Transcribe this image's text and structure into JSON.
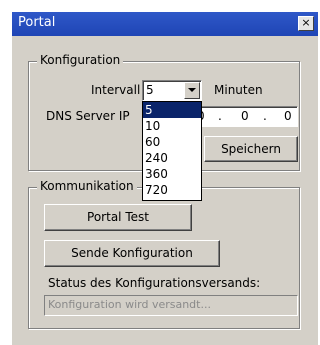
{
  "window": {
    "title": "Portal",
    "close_glyph": "×"
  },
  "konfiguration": {
    "legend": "Konfiguration",
    "intervall_label": "Intervall",
    "intervall_value": "5",
    "intervall_unit": "Minuten",
    "dns_label": "DNS Server IP",
    "ip_segments": [
      "0",
      ".",
      "0",
      ".",
      "0"
    ],
    "save_label": "Speichern",
    "intervall_options": [
      "5",
      "10",
      "60",
      "240",
      "360",
      "720"
    ]
  },
  "kommunikation": {
    "legend": "Kommunikation",
    "portal_test_label": "Portal Test",
    "sende_label": "Sende Konfiguration",
    "status_label": "Status des Konfigurationsversands:",
    "status_value": "Konfiguration wird versandt..."
  },
  "colors": {
    "titlebar": "#1f45b5",
    "selection": "#0a246a",
    "face": "#d4d0c8"
  }
}
